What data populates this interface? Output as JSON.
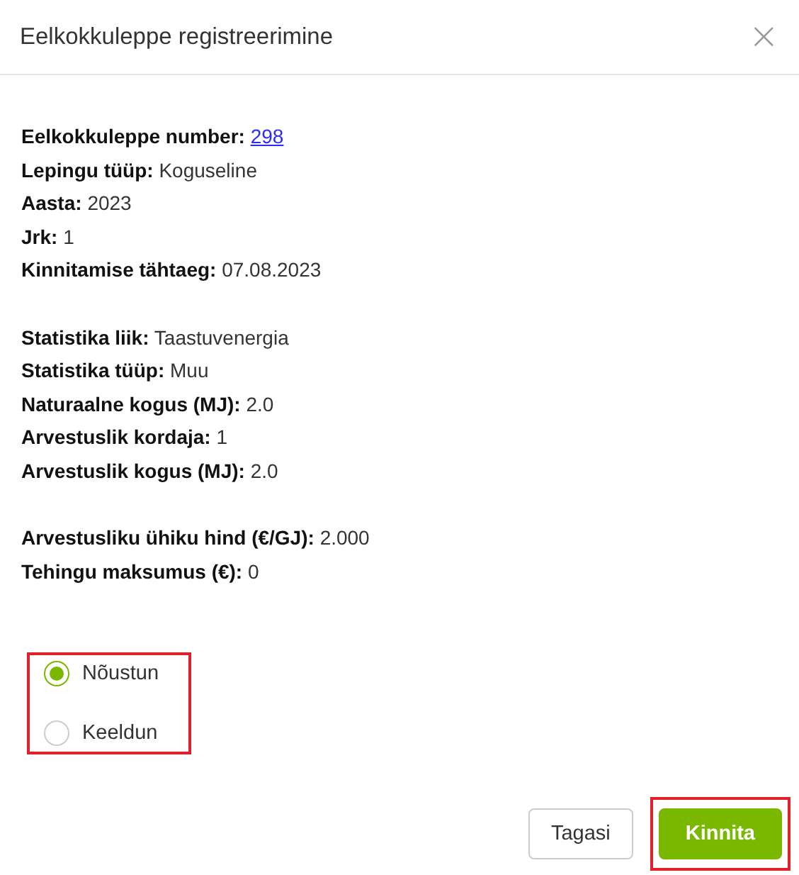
{
  "dialog": {
    "title": "Eelkokkuleppe registreerimine",
    "close": "×"
  },
  "field_groups": [
    [
      {
        "label": "Eelkokkuleppe number:",
        "value": "298",
        "kind": "link"
      },
      {
        "label": "Lepingu tüüp:",
        "value": "Koguseline",
        "kind": "text"
      },
      {
        "label": "Aasta:",
        "value": "2023",
        "kind": "text"
      },
      {
        "label": "Jrk:",
        "value": "1",
        "kind": "text"
      },
      {
        "label": "Kinnitamise tähtaeg:",
        "value": "07.08.2023",
        "kind": "text"
      }
    ],
    [
      {
        "label": "Statistika liik:",
        "value": "Taastuvenergia",
        "kind": "text"
      },
      {
        "label": "Statistika tüüp:",
        "value": "Muu",
        "kind": "text"
      },
      {
        "label": "Naturaalne kogus (MJ):",
        "value": "2.0",
        "kind": "text"
      },
      {
        "label": "Arvestuslik kordaja:",
        "value": "1",
        "kind": "text"
      },
      {
        "label": "Arvestuslik kogus (MJ):",
        "value": "2.0",
        "kind": "text"
      }
    ],
    [
      {
        "label": "Arvestusliku ühiku hind (€/GJ):",
        "value": "2.000",
        "kind": "text"
      },
      {
        "label": "Tehingu maksumus (€):",
        "value": "0",
        "kind": "text"
      }
    ]
  ],
  "choice": {
    "highlighted": true,
    "options": [
      {
        "label": "Nõustun",
        "selected": true
      },
      {
        "label": "Keeldun",
        "selected": false
      }
    ]
  },
  "buttons": [
    {
      "label": "Tagasi",
      "kind": "secondary",
      "highlighted": false
    },
    {
      "label": "Kinnita",
      "kind": "primary",
      "highlighted": true
    }
  ]
}
